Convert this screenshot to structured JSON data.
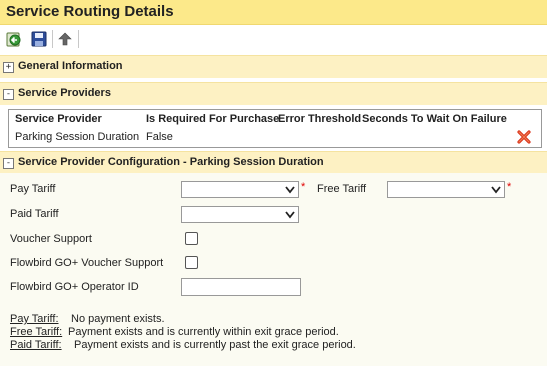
{
  "page": {
    "title": "Service Routing Details"
  },
  "toolbar": {
    "buttons": [
      {
        "name": "back-button",
        "icon": "back-icon"
      },
      {
        "name": "save-button",
        "icon": "save-icon"
      },
      {
        "name": "up-button",
        "icon": "up-arrow-icon"
      }
    ]
  },
  "sections": {
    "general": {
      "label": "General Information",
      "toggle": "+"
    },
    "providers": {
      "label": "Service Providers",
      "toggle": "-"
    },
    "config": {
      "label": "Service Provider Configuration - Parking Session Duration",
      "toggle": "-"
    }
  },
  "providers_table": {
    "columns": [
      "Service Provider",
      "Is Required For Purchase",
      "Error Threshold",
      "Seconds To Wait On Failure"
    ],
    "rows": [
      {
        "service_provider": "Parking Session Duration",
        "is_required": "False",
        "error_threshold": "",
        "seconds_to_wait": ""
      }
    ]
  },
  "config_form": {
    "pay_tariff_label": "Pay Tariff",
    "pay_tariff_value": "",
    "free_tariff_label": "Free Tariff",
    "free_tariff_value": "",
    "paid_tariff_label": "Paid Tariff",
    "paid_tariff_value": "",
    "voucher_support_label": "Voucher Support",
    "voucher_support_checked": false,
    "flowbird_voucher_label": "Flowbird GO+ Voucher Support",
    "flowbird_voucher_checked": false,
    "operator_id_label": "Flowbird GO+ Operator ID",
    "operator_id_value": "",
    "required_marker": "*"
  },
  "legend": [
    {
      "term": "Pay Tariff:",
      "desc": "No payment exists."
    },
    {
      "term": "Free Tariff:",
      "desc": "Payment exists and is currently within exit grace period."
    },
    {
      "term": "Paid Tariff:",
      "desc": "Payment exists and is currently past the exit grace period."
    }
  ],
  "colors": {
    "title_bar": "#fce98a",
    "section_header": "#fdf1c3",
    "required": "#e00000",
    "delete": "#d9331a"
  }
}
